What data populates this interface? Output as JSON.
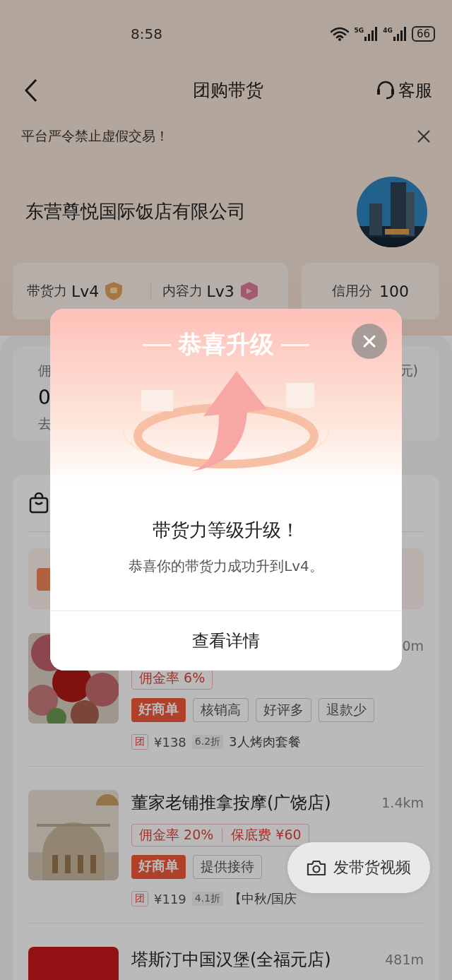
{
  "status_bar": {
    "time": "8:58",
    "networks": [
      "5G",
      "4G"
    ],
    "battery": "66"
  },
  "nav": {
    "title": "团购带货",
    "service": "客服"
  },
  "notice": {
    "text": "平台严令禁止虚假交易！"
  },
  "company": {
    "name": "东营尊悦国际饭店有限公司"
  },
  "levels": [
    {
      "label": "带货力",
      "value": "Lv4",
      "kind": "goods"
    },
    {
      "label": "内容力",
      "value": "Lv3",
      "kind": "content"
    }
  ],
  "credit": {
    "label": "信用分",
    "value": "100"
  },
  "stats": {
    "label": "佣",
    "value": "0",
    "link": "去",
    "unit": "元)"
  },
  "shops": [
    {
      "distance": "0m",
      "tags": [
        "佣金率 6%"
      ],
      "badges": [
        {
          "text": "好商单",
          "kind": "featured"
        },
        {
          "text": "核销高",
          "kind": "plain"
        },
        {
          "text": "好评多",
          "kind": "plain"
        },
        {
          "text": "退款少",
          "kind": "plain"
        }
      ],
      "deal_mark": "团",
      "price": "¥138",
      "discount": "6.2折",
      "deal": "3人烤肉套餐"
    },
    {
      "name": "董家老铺推拿按摩(广饶店)",
      "distance": "1.4km",
      "tags": [
        "佣金率 20%",
        "保底费 ¥60"
      ],
      "badges": [
        {
          "text": "好商单",
          "kind": "featured"
        },
        {
          "text": "提供接待",
          "kind": "plain"
        }
      ],
      "deal_mark": "团",
      "price": "¥119",
      "discount": "4.1折",
      "deal": "【中秋/国庆"
    },
    {
      "name": "塔斯汀中国汉堡(全福元店)",
      "distance": "481m"
    }
  ],
  "float_button": {
    "label": "发带货视频"
  },
  "modal": {
    "heading": "恭喜升级",
    "title": "带货力等级升级！",
    "message": "恭喜你的带货力成功升到Lv4。",
    "action": "查看详情"
  }
}
